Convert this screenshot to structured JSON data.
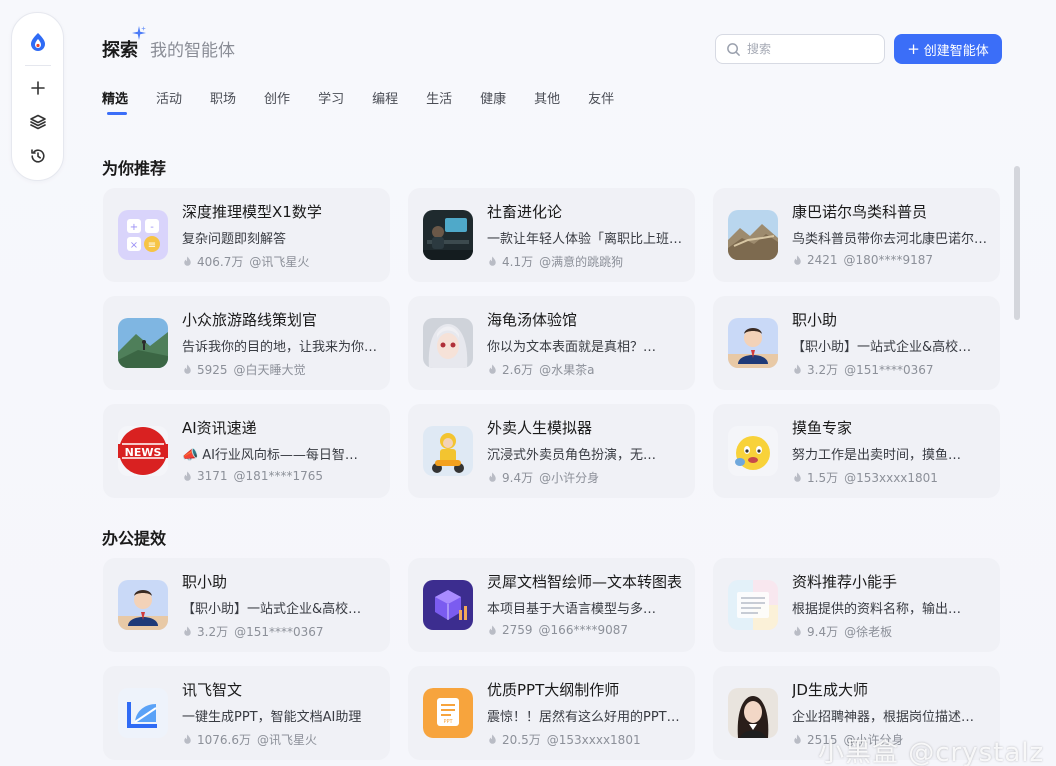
{
  "header": {
    "title": "探索",
    "subtitle": "我的智能体",
    "search_placeholder": "搜索",
    "create_label": "创建智能体",
    "accent": "#3b6ef8"
  },
  "rail": {
    "icons": [
      "app-logo-icon",
      "plus-icon",
      "layers-icon",
      "history-icon"
    ]
  },
  "tabs": [
    {
      "label": "精选",
      "active": true
    },
    {
      "label": "活动"
    },
    {
      "label": "职场"
    },
    {
      "label": "创作"
    },
    {
      "label": "学习"
    },
    {
      "label": "编程"
    },
    {
      "label": "生活"
    },
    {
      "label": "健康"
    },
    {
      "label": "其他"
    },
    {
      "label": "友伴"
    }
  ],
  "sections": [
    {
      "title": "为你推荐",
      "cards": [
        {
          "name": "深度推理模型X1数学",
          "desc": "复杂问题即刻解答",
          "count": "406.7万",
          "author": "@讯飞星火",
          "thumb": "calculator"
        },
        {
          "name": "社畜进化论",
          "desc": "一款让年轻人体验「离职比上班还难」的…",
          "count": "4.1万",
          "author": "@满意的跳跳狗",
          "thumb": "office-night"
        },
        {
          "name": "康巴诺尔鸟类科普员",
          "desc": "鸟类科普员带你去河北康巴诺尔…",
          "count": "2421",
          "author": "@180****9187",
          "thumb": "great-wall"
        },
        {
          "name": "小众旅游路线策划官",
          "desc": "告诉我你的目的地，让我来为你规划…",
          "count": "5925",
          "author": "@白天睡大觉",
          "thumb": "mountain"
        },
        {
          "name": "海龟汤体验馆",
          "desc": "你以为文本表面就是真相？…",
          "count": "2.6万",
          "author": "@水果茶a",
          "thumb": "anime-girl"
        },
        {
          "name": "职小助",
          "desc": "【职小助】一站式企业&高校…",
          "count": "3.2万",
          "author": "@151****0367",
          "thumb": "businessman"
        },
        {
          "name": "AI资讯速递",
          "desc": "AI行业风向标——每日智…",
          "count": "3171",
          "author": "@181****1765",
          "thumb": "news",
          "desc_icon": "megaphone-icon"
        },
        {
          "name": "外卖人生模拟器",
          "desc": "沉浸式外卖员角色扮演，无…",
          "count": "9.4万",
          "author": "@小许分身",
          "thumb": "delivery"
        },
        {
          "name": "摸鱼专家",
          "desc": "努力工作是出卖时间，摸鱼…",
          "count": "1.5万",
          "author": "@153xxxx1801",
          "thumb": "emoji"
        }
      ]
    },
    {
      "title": "办公提效",
      "cards": [
        {
          "name": "职小助",
          "desc": "【职小助】一站式企业&高校…",
          "count": "3.2万",
          "author": "@151****0367",
          "thumb": "businessman"
        },
        {
          "name": "灵犀文档智绘师—文本转图表",
          "desc": "本项目基于大语言模型与多…",
          "count": "2759",
          "author": "@166****9087",
          "thumb": "cube"
        },
        {
          "name": "资料推荐小能手",
          "desc": "根据提供的资料名称，输出…",
          "count": "9.4万",
          "author": "@徐老板",
          "thumb": "docs"
        },
        {
          "name": "讯飞智文",
          "desc": "一键生成PPT，智能文档AI助理",
          "count": "1076.6万",
          "author": "@讯飞星火",
          "thumb": "zhiwen"
        },
        {
          "name": "优质PPT大纲制作师",
          "desc": "震惊！！居然有这么好用的PPT…",
          "count": "20.5万",
          "author": "@153xxxx1801",
          "thumb": "ppt"
        },
        {
          "name": "JD生成大师",
          "desc": "企业招聘神器，根据岗位描述…",
          "count": "2515",
          "author": "@小许分身",
          "thumb": "woman"
        }
      ]
    }
  ],
  "watermark": "小黑盒 @crystalz"
}
